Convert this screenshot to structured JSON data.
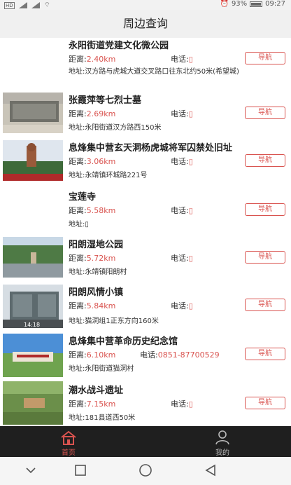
{
  "status_bar": {
    "left_text": "HD",
    "battery": "93%",
    "time": "09:27"
  },
  "header": {
    "title": "周边查询"
  },
  "labels": {
    "distance": "距离:",
    "phone": "电话:",
    "address": "地址:",
    "navigate": "导航"
  },
  "items": [
    {
      "name": "永阳街道党建文化微公园",
      "distance": "2.40km",
      "phone": "▯",
      "address": "汉方路与虎城大道交叉路口往东北约50米(希望城)"
    },
    {
      "name": "张霞萍等七烈士墓",
      "distance": "2.69km",
      "phone": "▯",
      "address": "永阳街道汉方路西150米"
    },
    {
      "name": "息烽集中营玄天洞杨虎城将军囚禁处旧址",
      "distance": "3.06km",
      "phone": "▯",
      "address": "永靖镇环城路221号"
    },
    {
      "name": "宝莲寺",
      "distance": "5.58km",
      "phone": "▯",
      "address": "▯"
    },
    {
      "name": "阳朗湿地公园",
      "distance": "5.72km",
      "phone": "▯",
      "address": "永靖镇阳朗村"
    },
    {
      "name": "阳朗风情小镇",
      "distance": "5.84km",
      "phone": "▯",
      "address": "猫洞组1正东方向160米",
      "thumb_caption": "14:18"
    },
    {
      "name": "息烽集中营革命历史纪念馆",
      "distance": "6.10km",
      "phone": "0851-87700529",
      "address": "永阳街道猫洞村"
    },
    {
      "name": "潮水战斗遗址",
      "distance": "7.15km",
      "phone": "▯",
      "address": "181县道西50米"
    }
  ],
  "bottom_nav": {
    "home": "首页",
    "me": "我的"
  },
  "colors": {
    "accent": "#d9534f",
    "nav_bg": "#1f1f1f"
  }
}
